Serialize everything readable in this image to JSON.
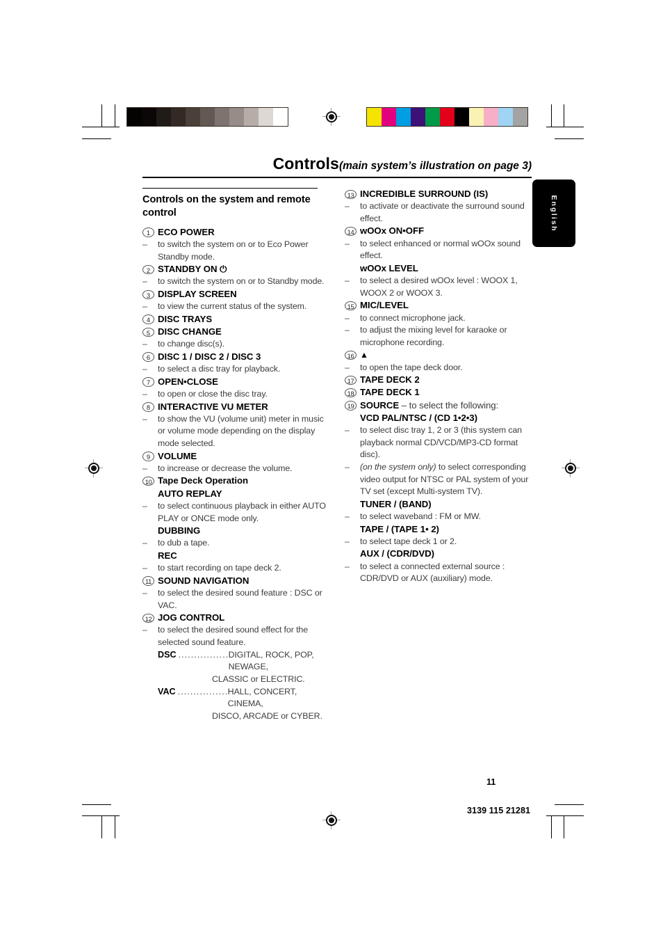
{
  "page": {
    "title_main": "Controls",
    "title_sub": "(main system’s illustration on page 3)",
    "language_tab": "English",
    "page_number": "11",
    "doc_code": "3139 115 21281"
  },
  "left_column": {
    "subheading": "Controls on the system and remote control",
    "items": [
      {
        "num": "1",
        "label": "ECO POWER",
        "descriptions": [
          "to switch the system on or to Eco Power Standby mode."
        ]
      },
      {
        "num": "2",
        "label": "STANDBY ON ⏻",
        "descriptions": [
          "to switch the system on or to Standby mode."
        ]
      },
      {
        "num": "3",
        "label": "DISPLAY SCREEN",
        "descriptions": [
          "to view the current status of the system."
        ]
      },
      {
        "num": "4",
        "label": "DISC TRAYS",
        "descriptions": []
      },
      {
        "num": "5",
        "label": "DISC CHANGE",
        "descriptions": [
          "to change disc(s)."
        ]
      },
      {
        "num": "6",
        "label": "DISC 1 / DISC 2 / DISC 3",
        "descriptions": [
          "to select a disc tray for playback."
        ]
      },
      {
        "num": "7",
        "label": "OPEN•CLOSE",
        "descriptions": [
          "to open or close the disc tray."
        ]
      },
      {
        "num": "8",
        "label": "INTERACTIVE VU METER",
        "descriptions": [
          "to show the VU (volume unit) meter in music or volume mode depending on the display mode selected."
        ]
      },
      {
        "num": "9",
        "label": "VOLUME",
        "descriptions": [
          "to increase or decrease the volume."
        ]
      },
      {
        "num": "10",
        "label": "Tape Deck Operation",
        "descriptions": [],
        "sub_entries": [
          {
            "label": "AUTO REPLAY",
            "descriptions": [
              "to select continuous playback in either AUTO PLAY or ONCE mode only."
            ]
          },
          {
            "label": "DUBBING",
            "descriptions": [
              "to dub a tape."
            ]
          },
          {
            "label": "REC",
            "descriptions": [
              "to start recording on tape deck 2."
            ]
          }
        ]
      },
      {
        "num": "11",
        "label": "SOUND NAVIGATION",
        "descriptions": [
          "to select the desired sound feature : DSC or VAC."
        ]
      },
      {
        "num": "12",
        "label": "JOG CONTROL",
        "descriptions": [
          "to select the desired sound effect for the selected sound feature."
        ],
        "leaders": [
          {
            "key": "DSC",
            "dots": "....................",
            "value": "DIGITAL, ROCK, POP, NEWAGE,",
            "cont": "CLASSIC or ELECTRIC."
          },
          {
            "key": "VAC",
            "dots": "....................",
            "value": "HALL, CONCERT, CINEMA,",
            "cont": "DISCO, ARCADE or CYBER."
          }
        ]
      }
    ]
  },
  "right_column": {
    "items": [
      {
        "num": "13",
        "label": "INCREDIBLE SURROUND (IS)",
        "descriptions": [
          "to activate or deactivate the surround sound effect."
        ]
      },
      {
        "num": "14",
        "label": "wOOx ON•OFF",
        "descriptions": [
          "to select enhanced or normal wOOx sound effect."
        ],
        "sub_entries": [
          {
            "label": "wOOx LEVEL",
            "descriptions": [
              "to select a desired wOOx level : WOOX 1, WOOX 2 or WOOX 3."
            ]
          }
        ]
      },
      {
        "num": "15",
        "label": "MIC/LEVEL",
        "descriptions": [
          "to connect microphone jack.",
          "to adjust the mixing level for karaoke or microphone recording."
        ]
      },
      {
        "num": "16",
        "label": "▲",
        "is_icon": true,
        "descriptions": [
          "to open the tape deck door."
        ]
      },
      {
        "num": "17",
        "label": "TAPE DECK 2",
        "descriptions": []
      },
      {
        "num": "18",
        "label": "TAPE DECK 1",
        "descriptions": []
      },
      {
        "num": "19",
        "label": "SOURCE",
        "label_suffix": " – to select the following:",
        "descriptions": [],
        "sub_entries": [
          {
            "label": "VCD PAL/NTSC / (CD 1•2•3)",
            "descriptions": [
              "to select disc tray 1, 2 or 3 (this system can playback normal CD/VCD/MP3-CD format disc)."
            ],
            "italic_descriptions": [
              {
                "italic": "(on the system only)",
                "rest": " to select corresponding video output for NTSC or PAL system of your TV set (except Multi-system TV)."
              }
            ]
          },
          {
            "label": "TUNER / (BAND)",
            "descriptions": [
              "to select waveband : FM or MW."
            ]
          },
          {
            "label": "TAPE / (TAPE 1• 2)",
            "descriptions": [
              "to select tape deck 1 or 2."
            ]
          },
          {
            "label": "AUX / (CDR/DVD)",
            "descriptions": [
              "to select a connected external source : CDR/DVD or AUX (auxiliary) mode."
            ]
          }
        ]
      }
    ]
  },
  "print_marks": {
    "grayscale_swatches": [
      "#050302",
      "#0b0706",
      "#211b17",
      "#332a25",
      "#4a3f39",
      "#635853",
      "#7e736e",
      "#978c87",
      "#b7ada8",
      "#ddd8d3",
      "#ffffff"
    ],
    "color_swatches": [
      "#f5e400",
      "#e3007e",
      "#009ee2",
      "#3d1178",
      "#009a49",
      "#e3001b",
      "#000000",
      "#faf2b4",
      "#f7afc8",
      "#9fd4f4",
      "#a3a3a3"
    ]
  }
}
